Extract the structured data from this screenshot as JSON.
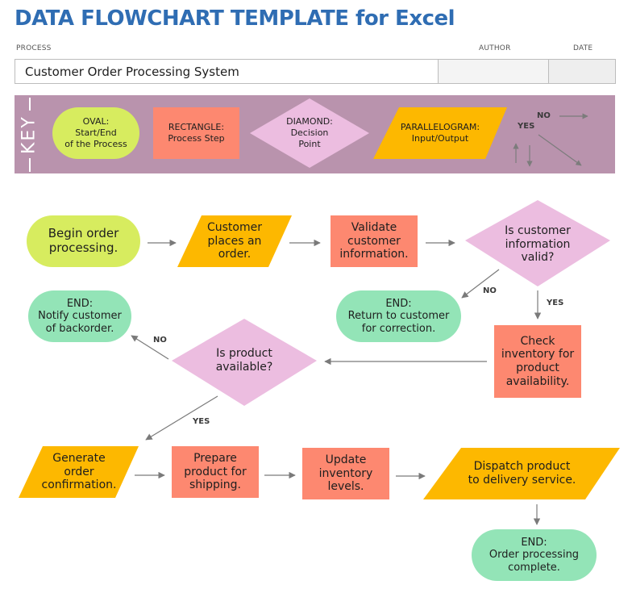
{
  "header": {
    "title": "DATA FLOWCHART TEMPLATE for Excel",
    "process_label": "PROCESS",
    "author_label": "AUTHOR",
    "date_label": "DATE",
    "process_value": "Customer Order Processing System",
    "author_value": "",
    "date_value": ""
  },
  "key": {
    "heading": "KEY",
    "oval": "OVAL:\nStart/End\nof the Process",
    "rectangle": "RECTANGLE:\nProcess Step",
    "diamond": "DIAMOND:\nDecision\nPoint",
    "parallelogram": "PARALLELOGRAM:\nInput/Output",
    "no_label": "NO",
    "yes_label": "YES"
  },
  "colors": {
    "title": "#2f6db3",
    "key_band": "#b993ad",
    "oval_start": "#d7ec5f",
    "oval_end": "#93e4b7",
    "rectangle": "#fd8870",
    "diamond": "#ecbde0",
    "parallelogram": "#fdb800",
    "arrow": "#7a7a7a"
  },
  "flow": {
    "begin": "Begin order\nprocessing.",
    "places_order": "Customer\nplaces an\norder.",
    "validate": "Validate\ncustomer\ninformation.",
    "is_valid": "Is customer\ninformation\nvalid?",
    "end_return": "END:\nReturn to customer\nfor correction.",
    "check_inventory": "Check\ninventory for\nproduct\navailability.",
    "is_available": "Is product\navailable?",
    "end_backorder": "END:\nNotify customer\nof backorder.",
    "generate_confirmation": "Generate\norder\nconfirmation.",
    "prepare_shipping": "Prepare\nproduct for\nshipping.",
    "update_inventory": "Update\ninventory\nlevels.",
    "dispatch": "Dispatch product\nto delivery service.",
    "end_complete": "END:\nOrder processing\ncomplete.",
    "valid_no": "NO",
    "valid_yes": "YES",
    "available_no": "NO",
    "available_yes": "YES"
  }
}
